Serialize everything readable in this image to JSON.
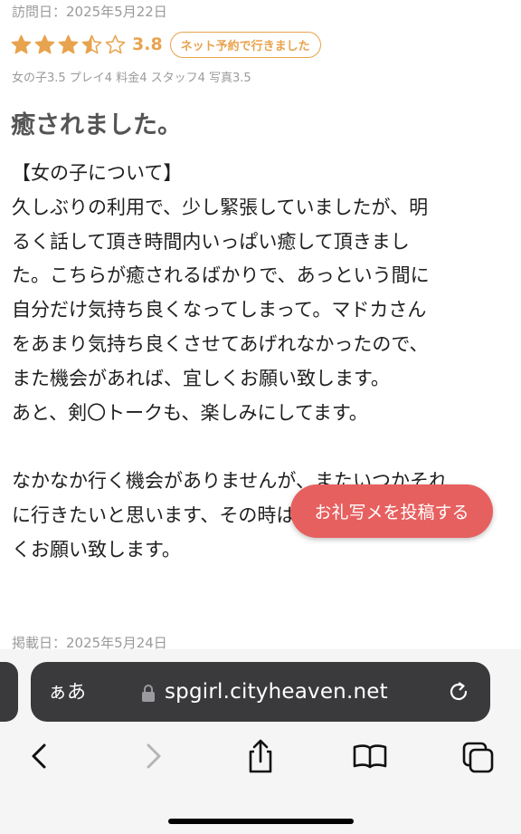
{
  "review": {
    "visit_date": "訪問日：2025年5月22日",
    "rating_value": "3.8",
    "stars": [
      1,
      1,
      1,
      0.5,
      0
    ],
    "reserve_badge": "ネット予約で行きました",
    "sub_ratings": "女の子3.5 プレイ4 料金4 スタッフ4 写真3.5",
    "title": "癒されました。",
    "body_lines": [
      "【女の子について】",
      "久しぶりの利用で、少し緊張していましたが、明",
      "るく話して頂き時間内いっぱい癒して頂きまし",
      "た。こちらが癒されるばかりで、あっという間に",
      "自分だけ気持ち良くなってしまって。マドカさん",
      "をあまり気持ち良くさせてあげれなかったので、",
      "また機会があれば、宜しくお願い致します。",
      "あと、剣〇トークも、楽しみにしてます。",
      "",
      "なかなか行く機会がありませんが、またいつかそれ",
      "に行きたいと思います、その時は、是非とも宜し",
      "くお願い致します。"
    ],
    "posted_date": "掲載日：2025年5月24日"
  },
  "fab": {
    "label": "お礼写メを投稿する"
  },
  "browser": {
    "aa_label": "ぁあ",
    "url": "spgirl.cityheaven.net",
    "icons": [
      "back-icon",
      "forward-icon",
      "share-icon",
      "bookmarks-icon",
      "tabs-icon",
      "lock-icon",
      "reload-icon"
    ]
  },
  "colors": {
    "accent_orange": "#e8a34e",
    "fab_red": "#e6605f",
    "address_bar": "#3a3a3c"
  }
}
